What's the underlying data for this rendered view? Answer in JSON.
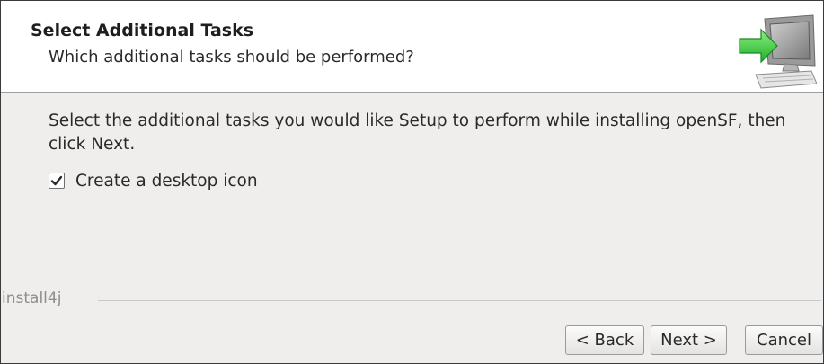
{
  "header": {
    "title": "Select Additional Tasks",
    "subtitle": "Which additional tasks should be performed?",
    "icon": "computer-with-arrow-icon"
  },
  "body": {
    "instruction": "Select the additional tasks you would like Setup to perform while installing openSF, then click Next."
  },
  "tasks": [
    {
      "label": "Create a desktop icon",
      "checked": true
    }
  ],
  "branding": {
    "label": "install4j"
  },
  "buttons": {
    "back": "< Back",
    "next": "Next >",
    "cancel": "Cancel"
  },
  "colors": {
    "header_bg": "#ffffff",
    "panel_bg": "#efeeec",
    "arrow_green": "#3fc94a",
    "text": "#2a2a2a",
    "brand_text": "#8e8e8e"
  }
}
